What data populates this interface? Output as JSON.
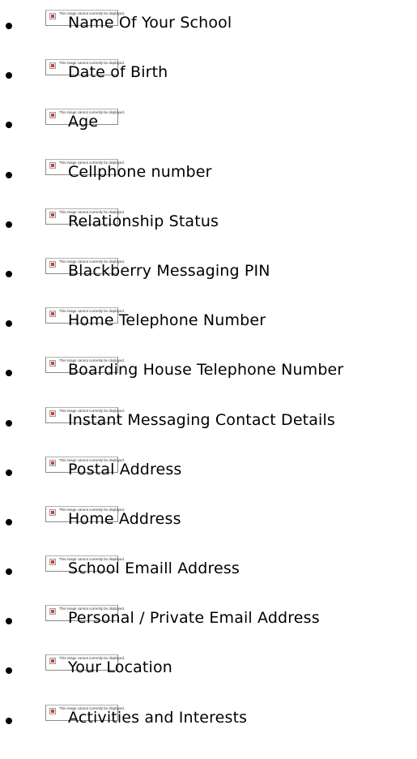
{
  "placeholder_text": "This image cannot currently be displayed.",
  "items": [
    {
      "label": "Name Of Your School"
    },
    {
      "label": "Date of Birth"
    },
    {
      "label": "Age"
    },
    {
      "label": "Cellphone number"
    },
    {
      "label": "Relationship Status"
    },
    {
      "label": "Blackberry Messaging PIN"
    },
    {
      "label": "Home Telephone Number"
    },
    {
      "label": "Boarding House Telephone Number"
    },
    {
      "label": "Instant Messaging Contact Details"
    },
    {
      "label": "Postal Address"
    },
    {
      "label": "Home Address"
    },
    {
      "label": "School Emaill Address"
    },
    {
      "label": "Personal / Private Email Address"
    },
    {
      "label": "Your Location"
    },
    {
      "label": "Activities and Interests"
    }
  ]
}
